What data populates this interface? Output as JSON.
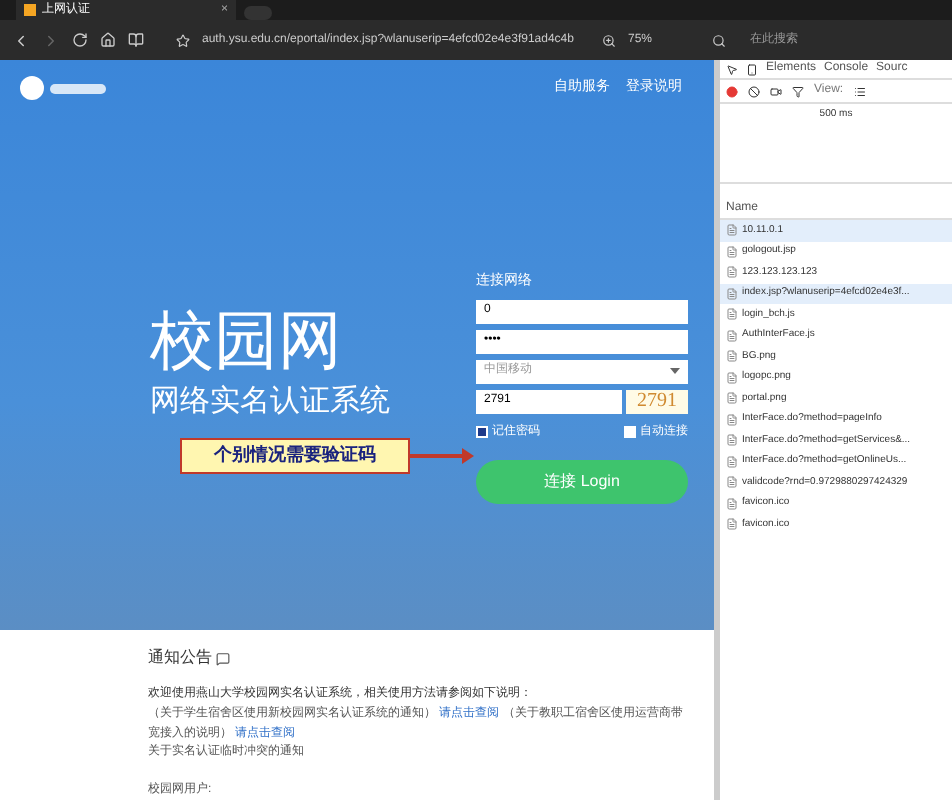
{
  "browser": {
    "tab_title": "上网认证",
    "close": "×",
    "url": "auth.ysu.edu.cn/eportal/index.jsp?wlanuserip=4efcd02e4e3f91ad4c4b",
    "zoom": "75%",
    "search_placeholder": "在此搜索"
  },
  "header": {
    "links": [
      "自助服务",
      "登录说明"
    ]
  },
  "hero": {
    "title": "校园网",
    "subtitle": "网络实名认证系统"
  },
  "login": {
    "heading": "连接网络",
    "username": "0",
    "password": "••••",
    "carrier": "中国移动",
    "captcha_value": "2791",
    "captcha_image": "2791",
    "remember": {
      "label": "记住密码",
      "checked": true
    },
    "auto": {
      "label": "自动连接",
      "checked": false
    },
    "button": "连接 Login"
  },
  "callout": "个别情况需要验证码",
  "notice": {
    "title": "通知公告",
    "intro": "欢迎使用燕山大学校园网实名认证系统，相关使用方法请参阅如下说明：",
    "lines": [
      {
        "text": "（关于学生宿舍区使用新校园网实名认证系统的通知）",
        "link": "请点击查阅"
      },
      {
        "text": "（关于教职工宿舍区使用运营商带宽接入的说明）",
        "link": "请点击查阅"
      }
    ],
    "extra": "关于实名认证临时冲突的通知",
    "footer": "校园网用户:"
  },
  "devtools": {
    "tabs": [
      {
        "label": "Elements",
        "selected": false
      },
      {
        "label": "Console",
        "selected": false
      },
      {
        "label": "Sourc",
        "selected": false
      }
    ],
    "view_label": "View:",
    "timeline_label": "500 ms",
    "column": "Name",
    "requests": [
      {
        "name": "10.11.0.1",
        "selected": true
      },
      {
        "name": "gologout.jsp",
        "selected": false
      },
      {
        "name": "123.123.123.123",
        "selected": false
      },
      {
        "name": "index.jsp?wlanuserip=4efcd02e4e3f...",
        "selected": true
      },
      {
        "name": "login_bch.js",
        "selected": false
      },
      {
        "name": "AuthInterFace.js",
        "selected": false
      },
      {
        "name": "BG.png",
        "selected": false
      },
      {
        "name": "logopc.png",
        "selected": false
      },
      {
        "name": "portal.png",
        "selected": false
      },
      {
        "name": "InterFace.do?method=pageInfo",
        "selected": false
      },
      {
        "name": "InterFace.do?method=getServices&...",
        "selected": false
      },
      {
        "name": "InterFace.do?method=getOnlineUs...",
        "selected": false
      },
      {
        "name": "validcode?rnd=0.9729880297424329",
        "selected": false
      },
      {
        "name": "favicon.ico",
        "selected": false
      },
      {
        "name": "favicon.ico",
        "selected": false
      }
    ]
  }
}
